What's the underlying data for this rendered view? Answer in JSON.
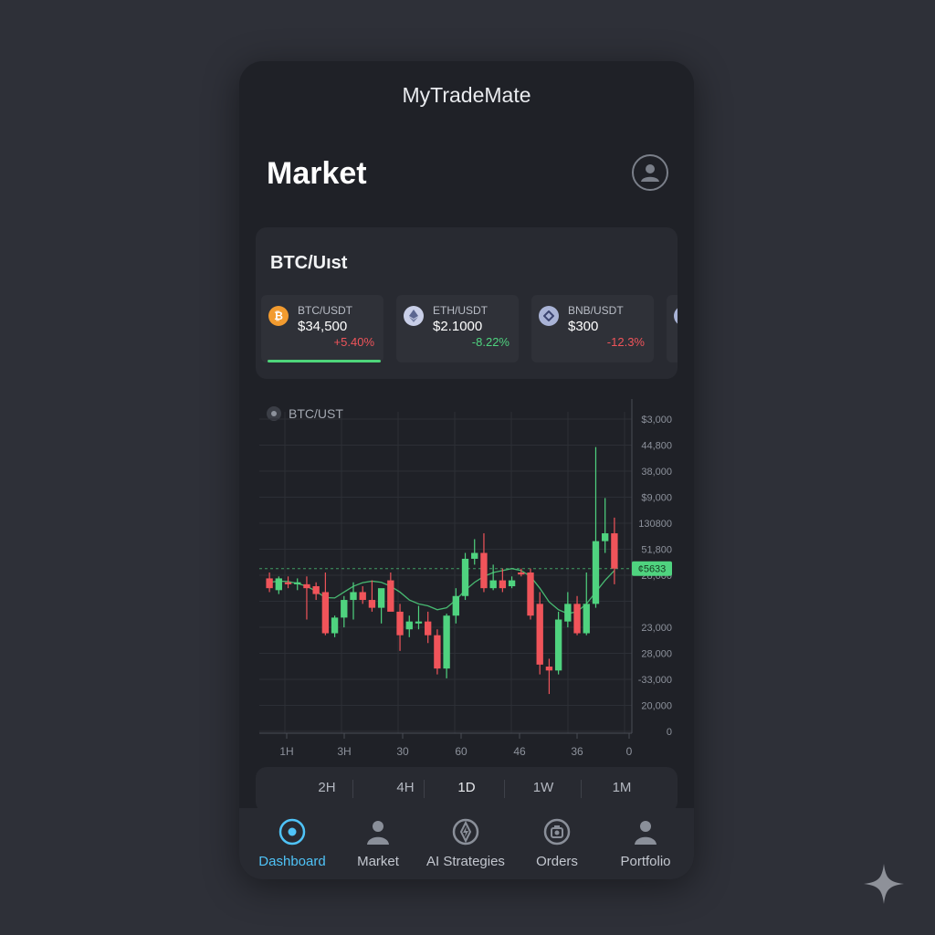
{
  "app": {
    "title": "MyTradeMate",
    "page_title": "Market"
  },
  "ticker_card": {
    "title": "BTC/Uıst",
    "tickers": [
      {
        "pair": "BTC/USDT",
        "price": "$34,500",
        "change": "+5.40%",
        "direction": "down",
        "coin_icon": "bitcoin-icon",
        "coin_color": "#f29b2f"
      },
      {
        "pair": "ETH/USDT",
        "price": "$2.1000",
        "change": "-8.22%",
        "direction": "up",
        "coin_icon": "ethereum-icon",
        "coin_color": "#c9cfe8"
      },
      {
        "pair": "BNB/USDT",
        "price": "$300",
        "change": "-12.3%",
        "direction": "down",
        "coin_icon": "bnb-icon",
        "coin_color": "#a9b3d6"
      }
    ]
  },
  "chart": {
    "label": "BTC/UST",
    "price_tag": "¢5633"
  },
  "chart_data": {
    "type": "candlestick",
    "y_tick_labels": [
      "$3,000",
      "44,800",
      "38,000",
      "$9,000",
      "130800",
      "51,800",
      "28,000",
      "",
      "23,000",
      "28,000",
      "-33,000",
      "20,000",
      "0"
    ],
    "x_tick_labels": [
      "1H",
      "3H",
      "30",
      "60",
      "46",
      "36",
      "0"
    ],
    "candles": [
      {
        "o": 1.35,
        "h": 1.5,
        "l": 1.0,
        "c": 1.1
      },
      {
        "o": 1.05,
        "h": 1.4,
        "l": 0.95,
        "c": 1.35
      },
      {
        "o": 1.25,
        "h": 1.4,
        "l": 1.1,
        "c": 1.2
      },
      {
        "o": 1.2,
        "h": 1.35,
        "l": 1.05,
        "c": 1.25
      },
      {
        "o": 1.2,
        "h": 1.4,
        "l": 0.3,
        "c": 1.1
      },
      {
        "o": 1.15,
        "h": 1.25,
        "l": 0.8,
        "c": 0.95
      },
      {
        "o": 1.0,
        "h": 1.5,
        "l": -0.1,
        "c": -0.05
      },
      {
        "o": -0.05,
        "h": 0.4,
        "l": -0.15,
        "c": 0.35
      },
      {
        "o": 0.35,
        "h": 0.9,
        "l": 0.1,
        "c": 0.8
      },
      {
        "o": 0.8,
        "h": 1.25,
        "l": 0.3,
        "c": 1.0
      },
      {
        "o": 1.0,
        "h": 1.15,
        "l": 0.7,
        "c": 0.8
      },
      {
        "o": 0.8,
        "h": 1.3,
        "l": 0.5,
        "c": 0.6
      },
      {
        "o": 0.6,
        "h": 0.95,
        "l": 0.2,
        "c": 1.1
      },
      {
        "o": 1.3,
        "h": 1.5,
        "l": 1.0,
        "c": 0.5
      },
      {
        "o": 0.5,
        "h": 0.7,
        "l": -0.5,
        "c": -0.1
      },
      {
        "o": 0.05,
        "h": 0.4,
        "l": -0.15,
        "c": 0.25
      },
      {
        "o": 0.2,
        "h": 0.65,
        "l": 0.05,
        "c": 0.25
      },
      {
        "o": 0.25,
        "h": 0.5,
        "l": -0.3,
        "c": -0.1
      },
      {
        "o": -0.1,
        "h": 0.05,
        "l": -1.1,
        "c": -0.95
      },
      {
        "o": -0.95,
        "h": 0.45,
        "l": -1.2,
        "c": 0.4
      },
      {
        "o": 0.4,
        "h": 1.1,
        "l": 0.2,
        "c": 0.9
      },
      {
        "o": 0.9,
        "h": 2.0,
        "l": 0.8,
        "c": 1.85
      },
      {
        "o": 1.85,
        "h": 2.35,
        "l": 1.7,
        "c": 2.0
      },
      {
        "o": 2.0,
        "h": 2.5,
        "l": 1.0,
        "c": 1.1
      },
      {
        "o": 1.1,
        "h": 1.7,
        "l": 1.05,
        "c": 1.3
      },
      {
        "o": 1.3,
        "h": 1.6,
        "l": 1.0,
        "c": 1.1
      },
      {
        "o": 1.15,
        "h": 1.4,
        "l": 1.1,
        "c": 1.3
      },
      {
        "o": 1.5,
        "h": 1.6,
        "l": 1.4,
        "c": 1.45
      },
      {
        "o": 1.5,
        "h": 1.6,
        "l": 0.3,
        "c": 0.4
      },
      {
        "o": 0.7,
        "h": 1.0,
        "l": -1.1,
        "c": -0.85
      },
      {
        "o": -0.9,
        "h": -0.7,
        "l": -1.6,
        "c": -1.0
      },
      {
        "o": -1.0,
        "h": 0.5,
        "l": -1.1,
        "c": 0.3
      },
      {
        "o": 0.25,
        "h": 1.0,
        "l": 0.1,
        "c": 0.7
      },
      {
        "o": 0.7,
        "h": 0.9,
        "l": -0.1,
        "c": -0.05
      },
      {
        "o": -0.05,
        "h": 1.5,
        "l": -0.1,
        "c": 0.7
      },
      {
        "o": 0.7,
        "h": 4.7,
        "l": 0.6,
        "c": 2.3
      },
      {
        "o": 2.3,
        "h": 3.4,
        "l": 2.0,
        "c": 2.5
      },
      {
        "o": 2.5,
        "h": 2.9,
        "l": 1.2,
        "c": 1.6
      }
    ],
    "moving_average": [
      1.25,
      1.28,
      1.27,
      1.22,
      1.15,
      1.02,
      0.86,
      0.85,
      1.0,
      1.15,
      1.24,
      1.28,
      1.25,
      1.15,
      1.0,
      0.8,
      0.7,
      0.65,
      0.55,
      0.6,
      0.8,
      1.05,
      1.25,
      1.4,
      1.5,
      1.55,
      1.6,
      1.55,
      1.4,
      1.1,
      0.75,
      0.55,
      0.45,
      0.5,
      0.7,
      1.0,
      1.3,
      1.55
    ],
    "current_price_level": 1.6,
    "up_color": "#4fd37f",
    "down_color": "#f0545a",
    "grid": true
  },
  "timeframes": {
    "options": [
      "2H",
      "4H",
      "1D",
      "1W",
      "1M"
    ],
    "selected": "1D"
  },
  "nav": {
    "items": [
      {
        "label": "Dashboard",
        "icon": "dashboard-icon",
        "active": true
      },
      {
        "label": "Market",
        "icon": "market-person-icon",
        "active": false
      },
      {
        "label": "AI Strategies",
        "icon": "ai-strategies-icon",
        "active": false
      },
      {
        "label": "Orders",
        "icon": "orders-icon",
        "active": false
      },
      {
        "label": "Portfolio",
        "icon": "portfolio-icon",
        "active": false
      }
    ]
  },
  "colors": {
    "accent": "#4fc3f7",
    "up": "#4fd37f",
    "down": "#f0545a",
    "background": "#2e3038",
    "panel": "#1f2127"
  }
}
